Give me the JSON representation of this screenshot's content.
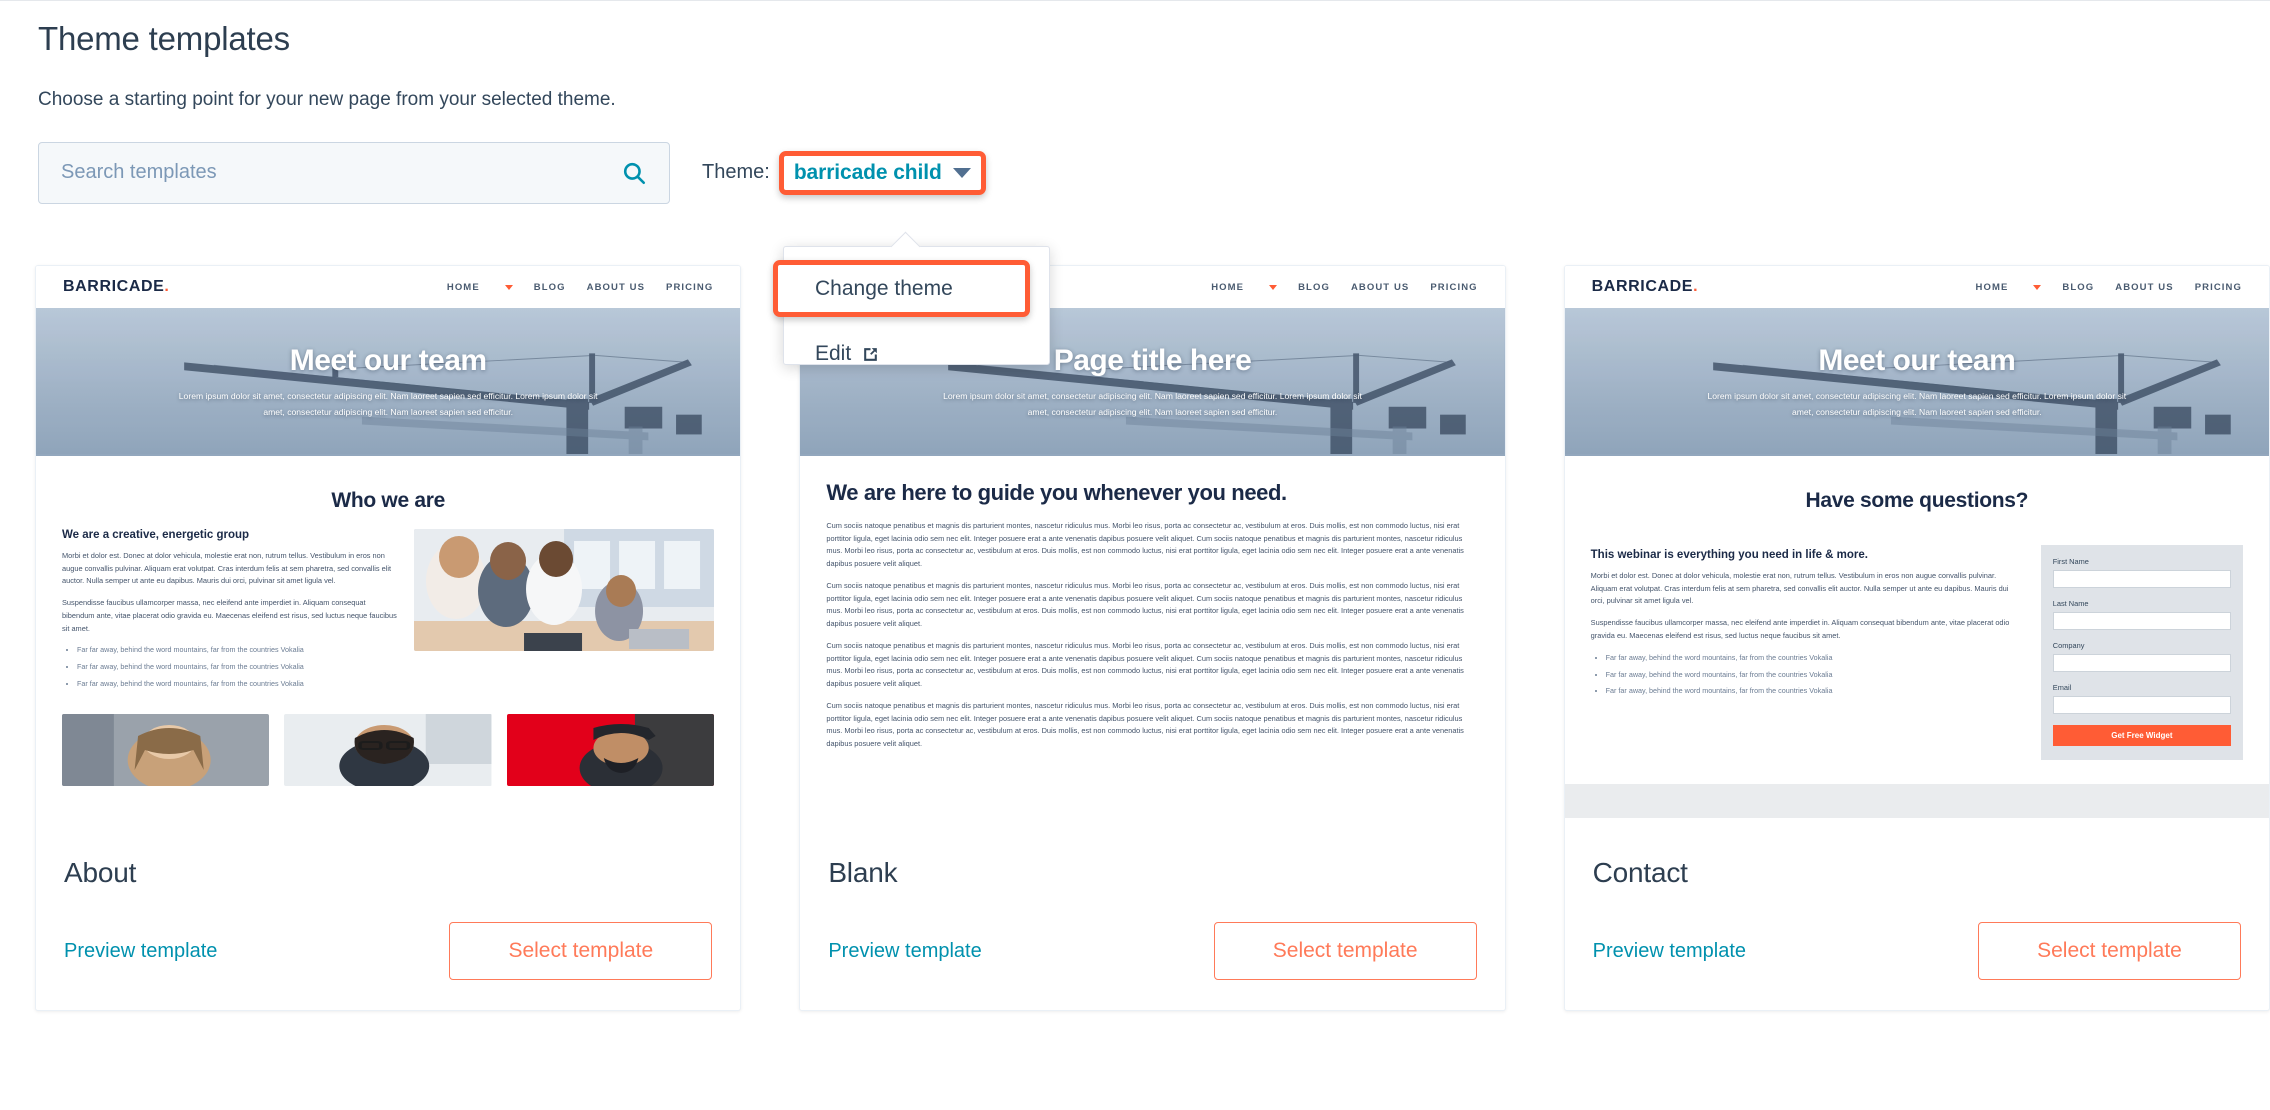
{
  "header": {
    "title": "Theme templates",
    "subtitle": "Choose a starting point for your new page from your selected theme."
  },
  "search": {
    "placeholder": "Search templates",
    "value": "",
    "icon": "search-icon"
  },
  "theme_selector": {
    "label": "Theme:",
    "selected": "barricade child",
    "caret_icon": "chevron-down-icon",
    "highlight_color": "#ff5c35",
    "accent_color": "#0091ae"
  },
  "dropdown": {
    "items": [
      {
        "label": "Change theme",
        "highlighted": true,
        "icon": null
      },
      {
        "label": "Edit",
        "highlighted": false,
        "icon": "external-link-icon"
      }
    ]
  },
  "preview_site": {
    "brand": "BARRICADE",
    "brand_dot": ".",
    "nav": [
      "HOME",
      "BLOG",
      "ABOUT US",
      "PRICING"
    ],
    "hero_paragraph": "Lorem ipsum dolor sit amet, consectetur adipiscing elit. Nam laoreet sapien sed efficitur. Lorem ipsum dolor sit amet, consectetur adipiscing elit. Nam laoreet sapien sed efficitur."
  },
  "common": {
    "preview_label": "Preview template",
    "select_label": "Select template"
  },
  "cards": [
    {
      "name": "About",
      "hero_title": "Meet our team",
      "section_title": "Who we are",
      "sub_head": "We are a creative, energetic group",
      "paragraphs": [
        "Morbi et dolor est. Donec at dolor vehicula, molestie erat non, rutrum tellus. Vestibulum in eros non augue convallis pulvinar. Aliquam erat volutpat. Cras interdum felis at sem pharetra, sed convallis elit auctor. Nulla semper ut ante eu dapibus. Mauris dui orci, pulvinar sit amet ligula vel.",
        "Suspendisse faucibus ullamcorper massa, nec eleifend ante imperdiet in. Aliquam consequat bibendum ante, vitae placerat odio gravida eu. Maecenas eleifend est risus, sed luctus neque faucibus sit amet."
      ],
      "bullets": [
        "Far far away, behind the word mountains, far from the countries Vokalia",
        "Far far away, behind the word mountains, far from the countries Vokalia",
        "Far far away, behind the word mountains, far from the countries Vokalia"
      ]
    },
    {
      "name": "Blank",
      "hero_title": "Page title here",
      "section_title": "We are here to guide you whenever you need.",
      "paragraphs": [
        "Cum sociis natoque penatibus et magnis dis parturient montes, nascetur ridiculus mus. Morbi leo risus, porta ac consectetur ac, vestibulum at eros. Duis mollis, est non commodo luctus, nisi erat porttitor ligula, eget lacinia odio sem nec elit. Integer posuere erat a ante venenatis dapibus posuere velit aliquet. Cum sociis natoque penatibus et magnis dis parturient montes, nascetur ridiculus mus. Morbi leo risus, porta ac consectetur ac, vestibulum at eros. Duis mollis, est non commodo luctus, nisi erat porttitor ligula, eget lacinia odio sem nec elit. Integer posuere erat a ante venenatis dapibus posuere velit aliquet.",
        "Cum sociis natoque penatibus et magnis dis parturient montes, nascetur ridiculus mus. Morbi leo risus, porta ac consectetur ac, vestibulum at eros. Duis mollis, est non commodo luctus, nisi erat porttitor ligula, eget lacinia odio sem nec elit. Integer posuere erat a ante venenatis dapibus posuere velit aliquet. Cum sociis natoque penatibus et magnis dis parturient montes, nascetur ridiculus mus. Morbi leo risus, porta ac consectetur ac, vestibulum at eros. Duis mollis, est non commodo luctus, nisi erat porttitor ligula, eget lacinia odio sem nec elit. Integer posuere erat a ante venenatis dapibus posuere velit aliquet.",
        "Cum sociis natoque penatibus et magnis dis parturient montes, nascetur ridiculus mus. Morbi leo risus, porta ac consectetur ac, vestibulum at eros. Duis mollis, est non commodo luctus, nisi erat porttitor ligula, eget lacinia odio sem nec elit. Integer posuere erat a ante venenatis dapibus posuere velit aliquet. Cum sociis natoque penatibus et magnis dis parturient montes, nascetur ridiculus mus. Morbi leo risus, porta ac consectetur ac, vestibulum at eros. Duis mollis, est non commodo luctus, nisi erat porttitor ligula, eget lacinia odio sem nec elit. Integer posuere erat a ante venenatis dapibus posuere velit aliquet.",
        "Cum sociis natoque penatibus et magnis dis parturient montes, nascetur ridiculus mus. Morbi leo risus, porta ac consectetur ac, vestibulum at eros. Duis mollis, est non commodo luctus, nisi erat porttitor ligula, eget lacinia odio sem nec elit. Integer posuere erat a ante venenatis dapibus posuere velit aliquet. Cum sociis natoque penatibus et magnis dis parturient montes, nascetur ridiculus mus. Morbi leo risus, porta ac consectetur ac, vestibulum at eros. Duis mollis, est non commodo luctus, nisi erat porttitor ligula, eget lacinia odio sem nec elit. Integer posuere erat a ante venenatis dapibus posuere velit aliquet."
      ]
    },
    {
      "name": "Contact",
      "hero_title": "Meet our team",
      "section_title": "Have some questions?",
      "sub_head": "This webinar is everything you need in life & more.",
      "paragraphs": [
        "Morbi et dolor est. Donec at dolor vehicula, molestie erat non, rutrum tellus. Vestibulum in eros non augue convallis pulvinar. Aliquam erat volutpat. Cras interdum felis at sem pharetra, sed convallis elit auctor. Nulla semper ut ante eu dapibus. Mauris dui orci, pulvinar sit amet ligula vel.",
        "Suspendisse faucibus ullamcorper massa, nec eleifend ante imperdiet in. Aliquam consequat bibendum ante, vitae placerat odio gravida eu. Maecenas eleifend est risus, sed luctus neque faucibus sit amet."
      ],
      "bullets": [
        "Far far away, behind the word mountains, far from the countries Vokalia",
        "Far far away, behind the word mountains, far from the countries Vokalia",
        "Far far away, behind the word mountains, far from the countries Vokalia"
      ],
      "form": {
        "fields": [
          "First Name",
          "Last Name",
          "Company",
          "Email"
        ],
        "submit_label": "Get Free Widget"
      }
    }
  ]
}
